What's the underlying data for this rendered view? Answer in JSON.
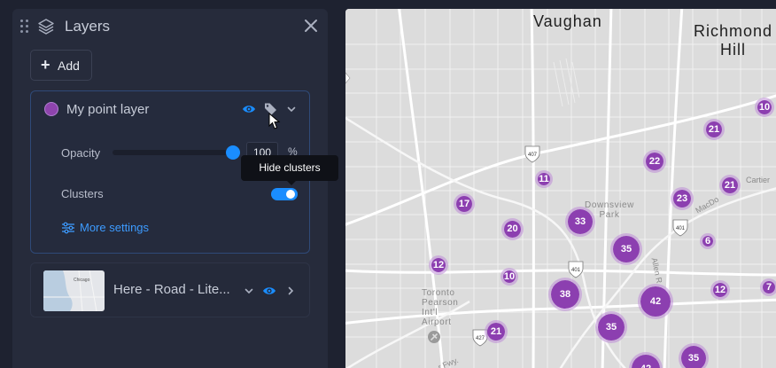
{
  "panel": {
    "title": "Layers",
    "add_button": {
      "plus": "+",
      "label": "Add"
    }
  },
  "point_layer": {
    "name": "My point layer",
    "color": "#8e44ad",
    "opacity_label": "Opacity",
    "opacity_value": "100",
    "opacity_unit": "%",
    "opacity_fraction": 1.0,
    "clusters_label": "Clusters",
    "clusters_enabled": true,
    "tooltip": "Hide clusters",
    "more_settings": "More settings"
  },
  "basemap_layer": {
    "name": "Here - Road - Lite...",
    "thumb_label": "Chicago"
  },
  "colors": {
    "accent": "#1a8dff",
    "link": "#3d9bff",
    "cluster": "#8c3fb0",
    "panel_bg": "#262b3b"
  },
  "icons": [
    "drag-handle-icon",
    "layers-icon",
    "close-icon",
    "plus-icon",
    "eye-icon",
    "tag-icon",
    "chevron-down-icon",
    "chevron-right-icon",
    "sliders-icon",
    "cursor-icon"
  ],
  "map": {
    "places": [
      {
        "id": "vaughan",
        "lines": [
          "Vaughan"
        ]
      },
      {
        "id": "richmond-hill",
        "lines": [
          "Richmond",
          "Hill"
        ]
      }
    ],
    "areas": [
      {
        "id": "downsview",
        "lines": [
          "Downsview",
          "Park"
        ]
      },
      {
        "id": "pearson",
        "lines": [
          "Toronto",
          "Pearson",
          "Int'l",
          "Airport"
        ]
      }
    ],
    "streets": [
      {
        "id": "cartier",
        "text": "Cartier"
      },
      {
        "id": "macdonald",
        "text": "MacDo"
      },
      {
        "id": "allen",
        "text": "Allen R"
      },
      {
        "id": "fwy",
        "text": "r Fwy."
      }
    ],
    "shields": [
      "407",
      "401",
      "401",
      "427"
    ],
    "clusters": [
      "21",
      "10",
      "22",
      "11",
      "23",
      "21",
      "17",
      "33",
      "20",
      "6",
      "35",
      "12",
      "10",
      "38",
      "42",
      "12",
      "7",
      "35",
      "21",
      "42",
      "35"
    ]
  }
}
